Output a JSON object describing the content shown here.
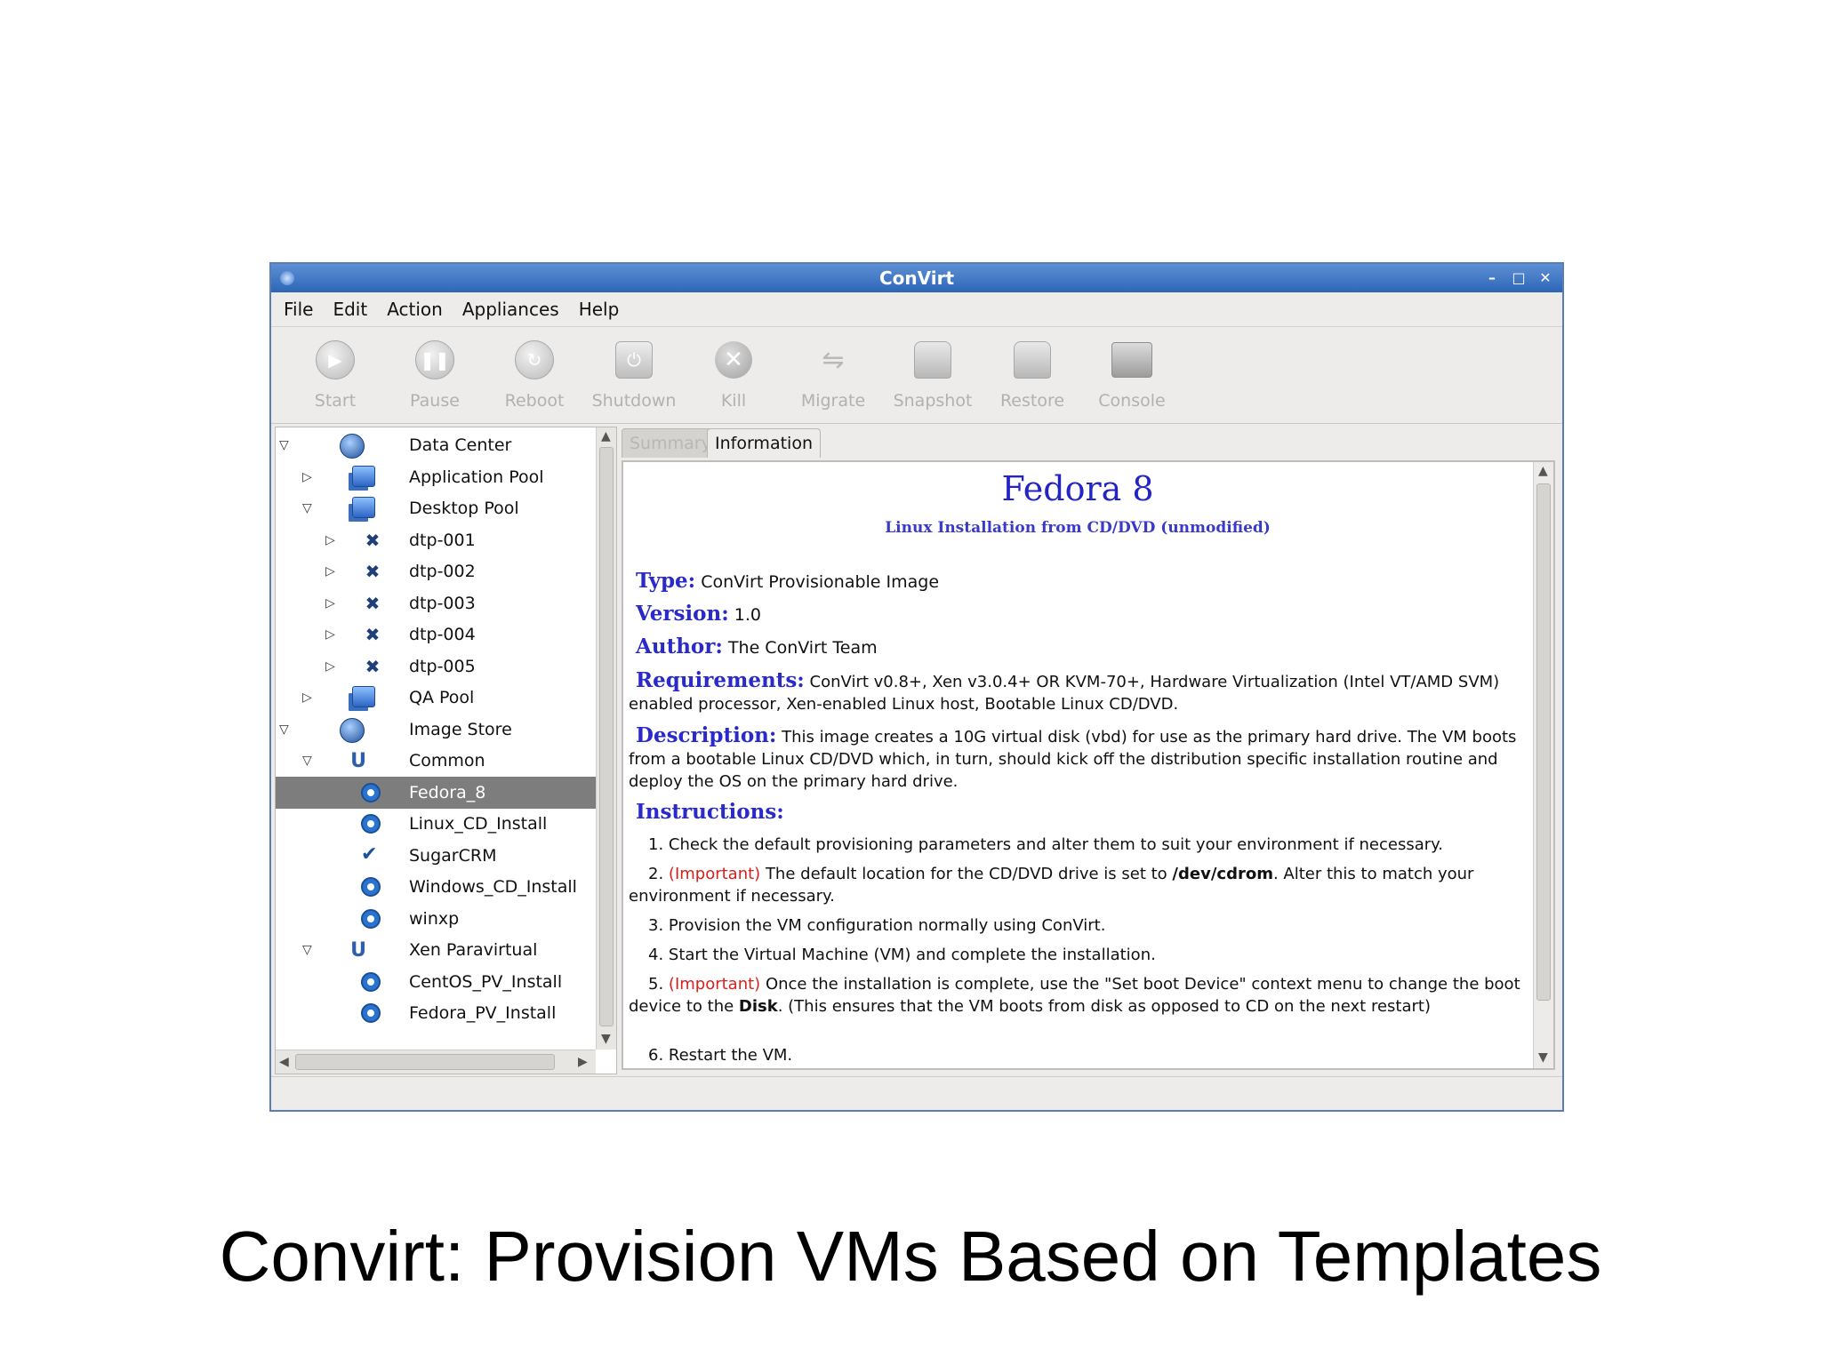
{
  "window": {
    "title": "ConVirt"
  },
  "menu": [
    "File",
    "Edit",
    "Action",
    "Appliances",
    "Help"
  ],
  "toolbar": [
    "Start",
    "Pause",
    "Reboot",
    "Shutdown",
    "Kill",
    "Migrate",
    "Snapshot",
    "Restore",
    "Console"
  ],
  "tree": [
    {
      "label": "Data Center",
      "icon": "globe-icon",
      "arrow": "expanded",
      "level": 0
    },
    {
      "label": "Application Pool",
      "icon": "server-pool-icon",
      "arrow": "collapsed",
      "level": 1
    },
    {
      "label": "Desktop Pool",
      "icon": "server-pool-icon",
      "arrow": "expanded",
      "level": 1
    },
    {
      "label": "dtp-001",
      "icon": "vm-host-icon",
      "arrow": "collapsed",
      "level": 2
    },
    {
      "label": "dtp-002",
      "icon": "vm-host-icon",
      "arrow": "collapsed",
      "level": 2
    },
    {
      "label": "dtp-003",
      "icon": "vm-host-icon",
      "arrow": "collapsed",
      "level": 2
    },
    {
      "label": "dtp-004",
      "icon": "vm-host-icon",
      "arrow": "collapsed",
      "level": 2
    },
    {
      "label": "dtp-005",
      "icon": "vm-host-icon",
      "arrow": "collapsed",
      "level": 2
    },
    {
      "label": "QA Pool",
      "icon": "server-pool-icon",
      "arrow": "collapsed",
      "level": 1
    },
    {
      "label": "Image Store",
      "icon": "globe-icon",
      "arrow": "expanded",
      "level": 0
    },
    {
      "label": "Common",
      "icon": "image-group-icon",
      "arrow": "expanded",
      "level": 1
    },
    {
      "label": "Fedora_8",
      "icon": "image-icon",
      "arrow": "",
      "level": 2,
      "selected": true
    },
    {
      "label": "Linux_CD_Install",
      "icon": "image-icon",
      "arrow": "",
      "level": 2
    },
    {
      "label": "SugarCRM",
      "icon": "check-image-icon",
      "arrow": "",
      "level": 2
    },
    {
      "label": "Windows_CD_Install",
      "icon": "image-icon",
      "arrow": "",
      "level": 2
    },
    {
      "label": "winxp",
      "icon": "image-icon",
      "arrow": "",
      "level": 2
    },
    {
      "label": "Xen Paravirtual",
      "icon": "image-group-icon",
      "arrow": "expanded",
      "level": 1
    },
    {
      "label": "CentOS_PV_Install",
      "icon": "image-icon",
      "arrow": "",
      "level": 2
    },
    {
      "label": "Fedora_PV_Install",
      "icon": "image-icon",
      "arrow": "",
      "level": 2
    }
  ],
  "tabs": {
    "summary": "Summary",
    "information": "Information"
  },
  "info": {
    "title": "Fedora 8",
    "subtitle": "Linux Installation from CD/DVD (unmodified)",
    "type_key": "Type:",
    "type_val": "ConVirt Provisionable Image",
    "version_key": "Version:",
    "version_val": "1.0",
    "author_key": "Author:",
    "author_val": "The ConVirt Team",
    "req_key": "Requirements:",
    "req_val": "ConVirt v0.8+, Xen v3.0.4+ OR KVM-70+, Hardware Virtualization (Intel VT/AMD SVM) enabled processor, Xen-enabled Linux host, Bootable Linux CD/DVD.",
    "desc_key": "Description:",
    "desc_val": "This image creates a 10G virtual disk (vbd) for use as the primary hard drive. The VM boots from a bootable Linux CD/DVD which, in turn, should kick off the distribution specific installation routine and deploy the OS on the primary hard drive.",
    "instr_key": "Instructions:",
    "step1": "1.  Check the default provisioning parameters and alter them to suit your environment if necessary.",
    "step2_num": "2.",
    "important": "(Important)",
    "step2_a": "The default location for the CD/DVD drive is set to",
    "step2_path": "/dev/cdrom",
    "step2_b": ". Alter this to match your environment if necessary.",
    "step3": "3.  Provision the VM configuration normally using ConVirt.",
    "step4": "4.  Start the Virtual Machine (VM) and complete the installation.",
    "step5_num": "5.",
    "step5_a": "Once the installation is complete, use the \"Set boot Device\" context menu to change the boot device to the",
    "step5_disk": "Disk",
    "step5_b": ". (This ensures that the VM boots from disk as opposed to CD on the next restart)",
    "step6": "6.  Restart the VM."
  },
  "caption": "Convirt: Provision VMs Based on Templates"
}
